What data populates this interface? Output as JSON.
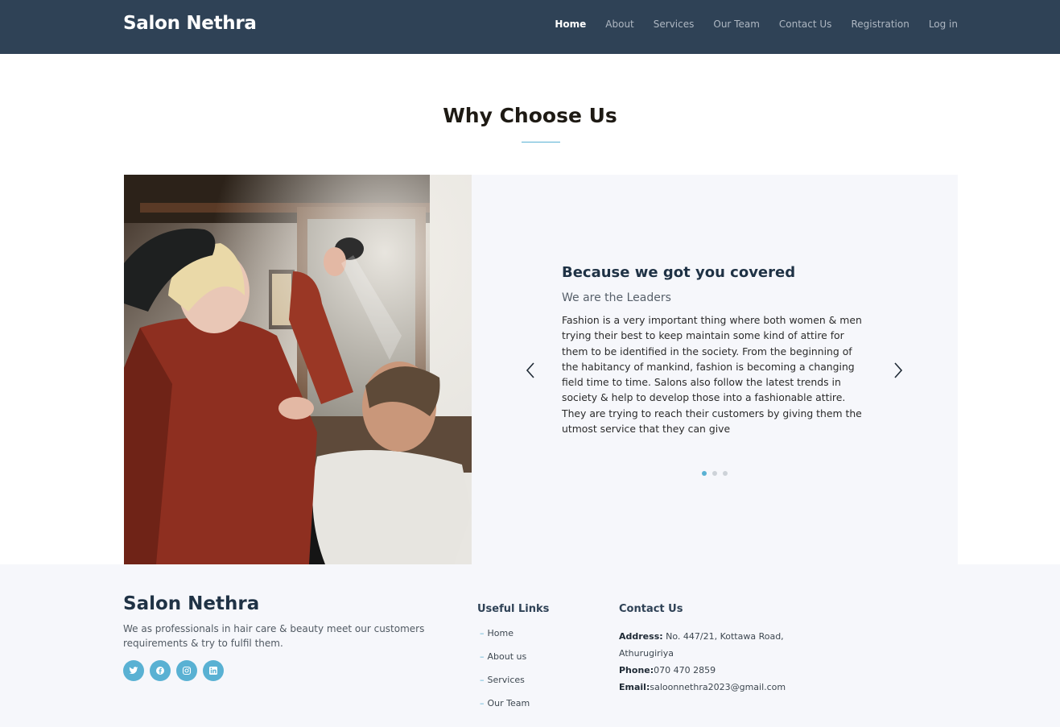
{
  "header": {
    "brand": "Salon Nethra",
    "nav": [
      "Home",
      "About",
      "Services",
      "Our Team",
      "Contact Us",
      "Registration",
      "Log in"
    ],
    "active": "Home"
  },
  "section": {
    "title": "Why Choose Us"
  },
  "slider": {
    "title": "Because we got you covered",
    "subtitle": "We are the Leaders",
    "text": "Fashion is a very important thing where both women & men trying their best to keep maintain some kind of attire for them to be identified in the society. From the beginning of the habitancy of mankind, fashion is becoming a changing field time to time. Salons also follow the latest trends in society & help to develop those into a fashionable attire. They are trying to reach their customers by giving them the utmost service that they can give",
    "dots": 3,
    "active_dot": 1,
    "image": "hairdresser-spraying-client-hair-photo"
  },
  "footer": {
    "brand": "Salon Nethra",
    "description": "We as professionals in hair care & beauty meet our customers requirements & try to fulfil them.",
    "socials": [
      "twitter-icon",
      "facebook-icon",
      "instagram-icon",
      "linkedin-icon"
    ],
    "useful_links_title": "Useful Links",
    "useful_links": [
      "Home",
      "About us",
      "Services",
      "Our Team"
    ],
    "contact_title": "Contact Us",
    "address_label": "Address:",
    "address": " No. 447/21, Kottawa Road, Athurugiriya",
    "phone_label": "Phone:",
    "phone": "070 470 2859",
    "email_label": "Email:",
    "email": "saloonnethra2023@gmail.com"
  },
  "colors": {
    "navbar": "#2f4256",
    "accent": "#59b1d3",
    "panel": "#f6f7fb"
  }
}
